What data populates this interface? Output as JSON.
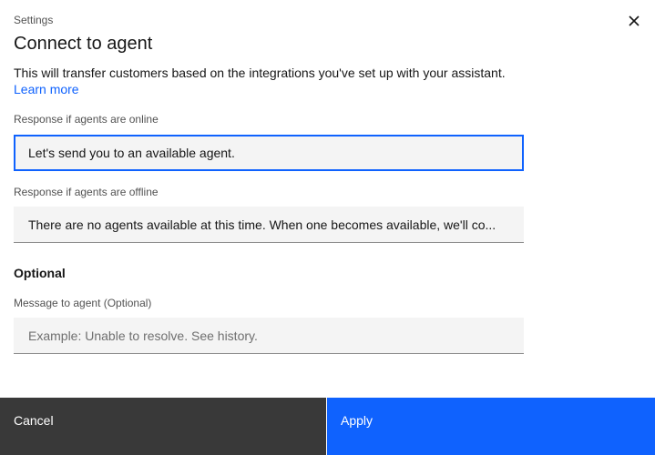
{
  "header": {
    "label": "Settings",
    "title": "Connect to agent",
    "close_icon": "close-icon"
  },
  "description": {
    "text": "This will transfer customers based on the integrations you've set up with your assistant.",
    "link": "Learn more"
  },
  "online": {
    "label": "Response if agents are online",
    "value": "Let's send you to an available agent."
  },
  "offline": {
    "label": "Response if agents are offline",
    "value": "There are no agents available at this time. When one becomes available, we'll co..."
  },
  "optional": {
    "heading": "Optional",
    "label": "Message to agent (Optional)",
    "value": "",
    "placeholder": "Example: Unable to resolve. See history."
  },
  "footer": {
    "cancel_label": "Cancel",
    "apply_label": "Apply"
  },
  "colors": {
    "accent": "#0f62fe",
    "cancel_bg": "#393939",
    "field_bg": "#f4f4f4"
  }
}
